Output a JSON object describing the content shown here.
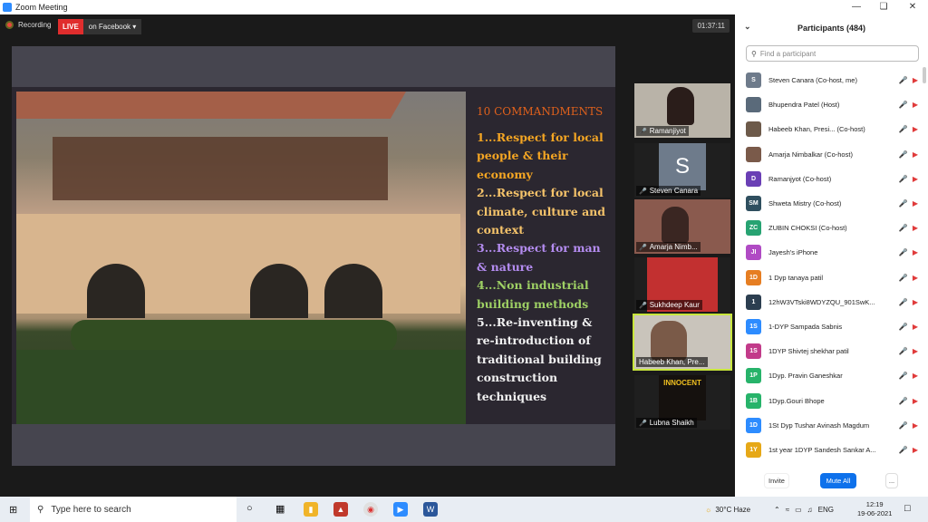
{
  "window": {
    "title": "Zoom Meeting"
  },
  "topbar": {
    "recording": "Recording",
    "live": "LIVE",
    "on_facebook": "on Facebook",
    "timer": "01:37:11"
  },
  "slide": {
    "title": "10 COMMANDMENTS",
    "points": [
      "1...Respect for local people & their economy",
      "2...Respect for local climate, culture and context",
      "3...Respect for man & nature",
      "4...Non industrial building methods",
      "5...Re-inventing & re-introduction of traditional building construction techniques"
    ]
  },
  "thumbnails": [
    {
      "name": "Ramanjiyot"
    },
    {
      "name": "Steven Canara",
      "initial": "S"
    },
    {
      "name": "Amarja Nimb..."
    },
    {
      "name": "Sukhdeep Kaur"
    },
    {
      "name": "Habeeb Khan, Pre..."
    },
    {
      "name": "Lubna Shaikh",
      "poster": "INNOCENT"
    }
  ],
  "participants_panel": {
    "title": "Participants (484)",
    "search_placeholder": "Find a participant",
    "rows": [
      {
        "initials": "S",
        "name": "Steven Canara (Co-host, me)",
        "color": "#6e7b8b"
      },
      {
        "initials": "",
        "name": "Bhupendra Patel (Host)",
        "color": "#5a6a7a"
      },
      {
        "initials": "",
        "name": "Habeeb Khan, Presi... (Co-host)",
        "color": "#6d5a4a"
      },
      {
        "initials": "",
        "name": "Amarja Nimbalkar (Co-host)",
        "color": "#7a5a4a"
      },
      {
        "initials": "D",
        "name": "Ramanjyot (Co-host)",
        "color": "#6a3fb5"
      },
      {
        "initials": "SM",
        "name": "Shweta Mistry (Co-host)",
        "color": "#2f4f5f"
      },
      {
        "initials": "ZC",
        "name": "ZUBIN CHOKSI (Co-host)",
        "color": "#27a372"
      },
      {
        "initials": "JI",
        "name": "Jayesh's iPhone",
        "color": "#b04bc4"
      },
      {
        "initials": "1D",
        "name": "1 Dyp tanaya patil",
        "color": "#e67e22"
      },
      {
        "initials": "1",
        "name": "12hW3VTski8WDYZQU_901SwK...",
        "color": "#2c3e50"
      },
      {
        "initials": "1S",
        "name": "1-DYP Sampada Sabnis",
        "color": "#2d8cff"
      },
      {
        "initials": "1S",
        "name": "1DYP Shivtej shekhar patil",
        "color": "#c23b8a"
      },
      {
        "initials": "1P",
        "name": "1Dyp. Pravin Ganeshkar",
        "color": "#27b36a"
      },
      {
        "initials": "1B",
        "name": "1Dyp.Gouri Bhope",
        "color": "#27b36a"
      },
      {
        "initials": "1D",
        "name": "1St Dyp Tushar Avinash Magdum",
        "color": "#2d8cff"
      },
      {
        "initials": "1Y",
        "name": "1st year 1DYP Sandesh Sankar A...",
        "color": "#e6a817"
      }
    ],
    "buttons": {
      "invite": "Invite",
      "mute_all": "Mute All",
      "more": "..."
    }
  },
  "taskbar": {
    "search_placeholder": "Type here to search",
    "weather": "30°C Haze",
    "lang": "ENG",
    "time": "12:19",
    "date": "19-06-2021"
  }
}
